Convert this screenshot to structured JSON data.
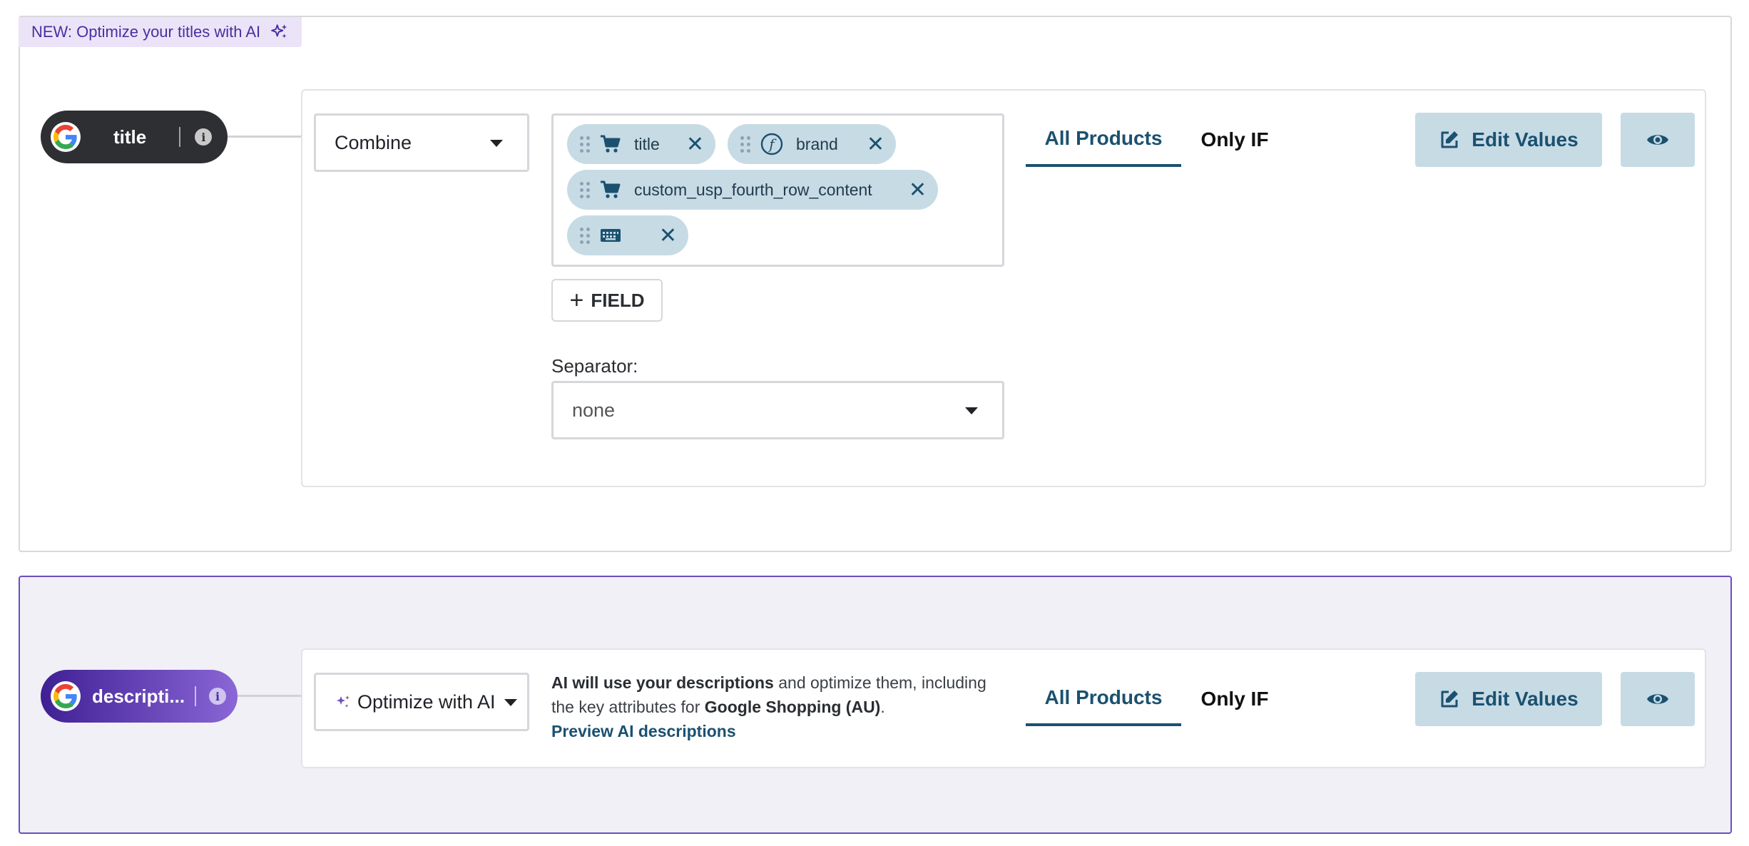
{
  "banner": {
    "text": "NEW: Optimize your titles with AI",
    "icon": "sparkles-icon"
  },
  "title_field": {
    "pill_label": "title",
    "mode": "Combine",
    "chips": [
      {
        "icon": "cart-icon",
        "label": "title"
      },
      {
        "icon": "function-icon",
        "label": "brand"
      },
      {
        "icon": "cart-icon",
        "label": "custom_usp_fourth_row_content"
      },
      {
        "icon": "keyboard-icon",
        "label": ""
      }
    ],
    "add_field_label": "FIELD",
    "separator_label": "Separator:",
    "separator_value": "none",
    "tabs": [
      "All Products",
      "Only IF"
    ],
    "edit_values_label": "Edit Values"
  },
  "description_field": {
    "pill_label": "descripti...",
    "mode": "Optimize with AI",
    "ai_text_bold1": "AI will use your descriptions",
    "ai_text_mid": " and optimize them, including the key attributes for ",
    "ai_text_bold2": "Google Shopping (AU)",
    "ai_text_end": ".",
    "ai_link": "Preview AI descriptions",
    "tabs": [
      "All Products",
      "Only IF"
    ],
    "edit_values_label": "Edit Values"
  },
  "colors": {
    "accent": "#1b5170",
    "chip_bg": "#c7dbe5",
    "ai_purple": "#6b4fbb",
    "pill_dark": "#2d2f33"
  }
}
